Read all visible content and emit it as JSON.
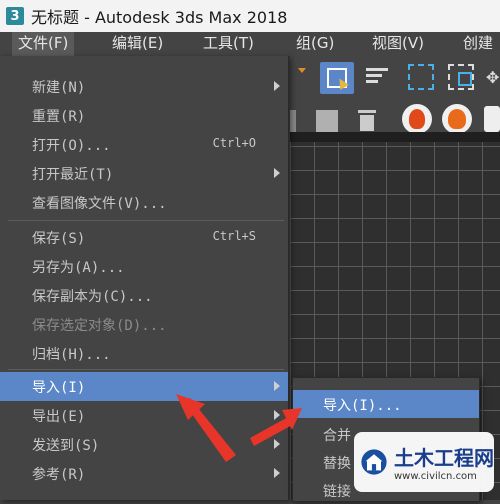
{
  "window": {
    "app_icon_glyph": "3",
    "title": "无标题 - Autodesk 3ds Max 2018"
  },
  "menubar": {
    "items": [
      {
        "label": "文件(F)",
        "active": true
      },
      {
        "label": "编辑(E)"
      },
      {
        "label": "工具(T)"
      },
      {
        "label": "组(G)"
      },
      {
        "label": "视图(V)"
      },
      {
        "label": "创建"
      }
    ]
  },
  "file_menu": {
    "items": [
      {
        "label": "新建(N)",
        "submenu": true
      },
      {
        "label": "重置(R)"
      },
      {
        "label": "打开(O)...",
        "shortcut": "Ctrl+O"
      },
      {
        "label": "打开最近(T)",
        "submenu": true
      },
      {
        "label": "查看图像文件(V)..."
      },
      {
        "label": "保存(S)",
        "shortcut": "Ctrl+S"
      },
      {
        "label": "另存为(A)..."
      },
      {
        "label": "保存副本为(C)..."
      },
      {
        "label": "保存选定对象(D)...",
        "disabled": true
      },
      {
        "label": "归档(H)..."
      },
      {
        "label": "导入(I)",
        "submenu": true,
        "highlighted": true
      },
      {
        "label": "导出(E)",
        "submenu": true
      },
      {
        "label": "发送到(S)",
        "submenu": true
      },
      {
        "label": "参考(R)",
        "submenu": true
      }
    ]
  },
  "import_submenu": {
    "items": [
      {
        "label": "导入(I)...",
        "highlighted": true
      },
      {
        "label": "合并"
      },
      {
        "label": "替换"
      },
      {
        "label": "链接"
      }
    ]
  },
  "toolbar_icons": [
    "select-region-icon",
    "filter-list-icon",
    "rectangle-select-icon",
    "window-crossing-icon",
    "move-icon",
    "delete-icon",
    "render-setup-icon",
    "render-frame-icon",
    "render-icon"
  ],
  "annotation_color": "#e8352a",
  "highlight_color": "#5b87c8",
  "watermark": {
    "title": "土木工程网",
    "url": "www.civilcn.com"
  }
}
